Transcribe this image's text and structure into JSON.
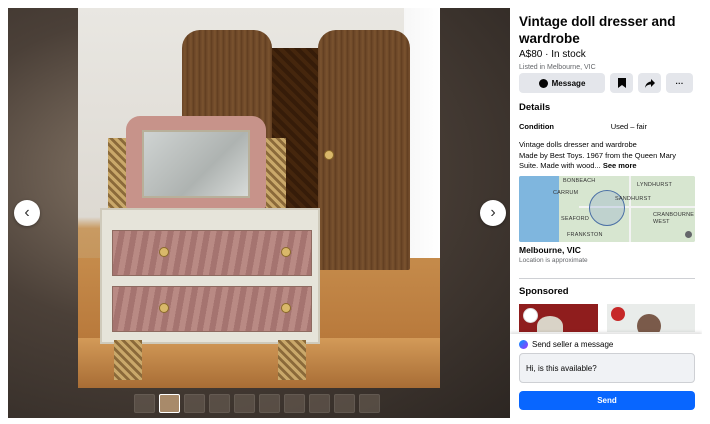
{
  "listing": {
    "title": "Vintage doll dresser and wardrobe",
    "price_status": "A$80 · In stock",
    "listed": "Listed in Melbourne, VIC"
  },
  "actions": {
    "message_label": "Message",
    "save_icon": "bookmark-icon",
    "share_icon": "share-arrow-icon",
    "more_label": "···"
  },
  "details": {
    "heading": "Details",
    "condition_key": "Condition",
    "condition_value": "Used – fair",
    "description_line1": "Vintage dolls dresser and wardrobe",
    "description_line2": "Made by Best Toys. 1967 from the Queen Mary",
    "description_line3": "Suite. Made with wood...",
    "see_more": "See more"
  },
  "map": {
    "labels": [
      "BONBEACH",
      "CARRUM",
      "LYNDHURST",
      "SANDHURST",
      "SEAFORD",
      "CRANBOURNE WEST",
      "FRANKSTON"
    ]
  },
  "location": {
    "name": "Melbourne, VIC",
    "note": "Location is approximate"
  },
  "sponsored": {
    "heading": "Sponsored"
  },
  "seller": {
    "heading": "Send seller a message",
    "input_value": "Hi, is this available?",
    "send_label": "Send"
  },
  "viewer": {
    "prev_icon": "chevron-left-icon",
    "next_icon": "chevron-right-icon",
    "thumb_count": 10,
    "active_thumb": 2
  },
  "colors": {
    "primary": "#0866ff",
    "button_bg": "#e4e6eb",
    "muted_text": "#65676b"
  }
}
